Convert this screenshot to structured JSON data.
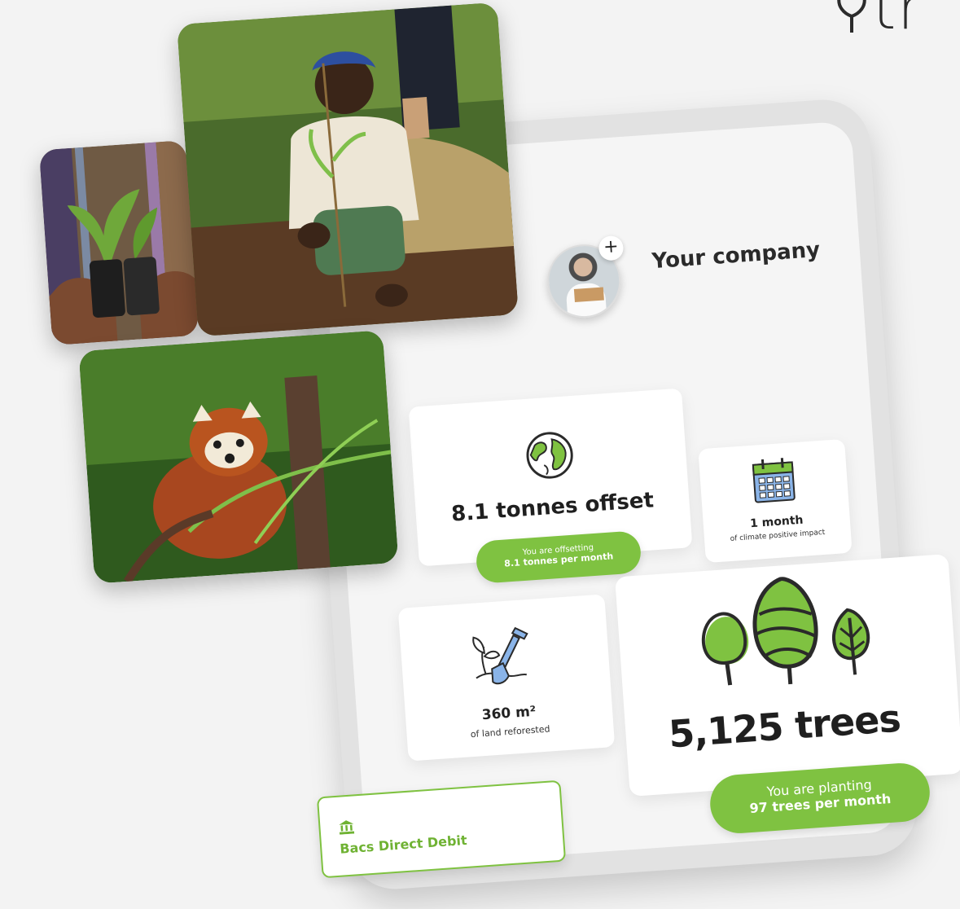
{
  "brand": {
    "text": "tr"
  },
  "profile": {
    "company_name": "Your company",
    "add_label": "+"
  },
  "stats": {
    "offset": {
      "value": "8.1 tonnes offset",
      "pill_line1": "You are offsetting",
      "pill_line2": "8.1 tonnes per month"
    },
    "month": {
      "value": "1 month",
      "caption": "of climate positive impact"
    },
    "land": {
      "value": "360 m²",
      "caption": "of land reforested"
    },
    "trees": {
      "value": "5,125 trees",
      "pill_line1": "You are planting",
      "pill_line2": "97 trees per month"
    }
  },
  "payment": {
    "method": "Bacs Direct Debit",
    "icon": "bank-icon"
  },
  "photos": [
    {
      "name": "seedling-photo"
    },
    {
      "name": "farmer-planting-photo"
    },
    {
      "name": "red-panda-photo"
    }
  ],
  "colors": {
    "accent": "#7fc241",
    "accent_text": "#6fb233",
    "background": "#f3f3f3"
  }
}
